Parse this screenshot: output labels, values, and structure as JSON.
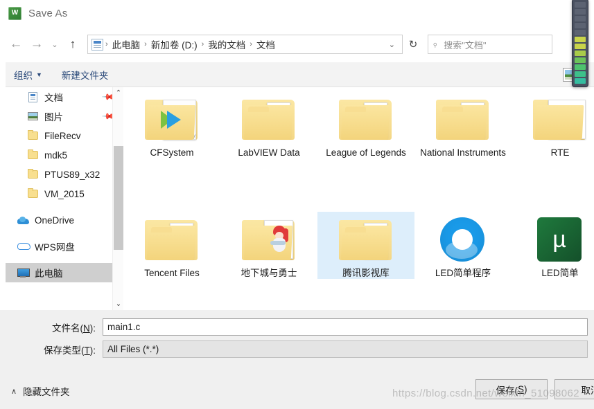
{
  "window": {
    "title": "Save As",
    "app_icon": "wps-icon"
  },
  "nav": {
    "back_icon": "arrow-left-icon",
    "forward_icon": "arrow-right-icon",
    "recent_icon": "chevron-down-icon",
    "up_icon": "arrow-up-icon",
    "refresh_icon": "refresh-icon",
    "address_icon": "document-icon",
    "breadcrumbs": [
      "此电脑",
      "新加卷 (D:)",
      "我的文档",
      "文档"
    ],
    "separator": "›",
    "dropdown_icon": "chevron-down-icon"
  },
  "search": {
    "placeholder": "搜索\"文档\"",
    "icon": "search-icon"
  },
  "toolbar": {
    "organize_label": "组织",
    "organize_caret": "▼",
    "new_folder_label": "新建文件夹",
    "view_icon": "view-layout-icon",
    "view_caret": "▼"
  },
  "sidebar": {
    "items": [
      {
        "label": "文档",
        "icon": "document-icon",
        "indent": true,
        "pinned": true,
        "selected": false
      },
      {
        "label": "图片",
        "icon": "picture-icon",
        "indent": true,
        "pinned": true,
        "selected": false
      },
      {
        "label": "FileRecv",
        "icon": "folder-icon",
        "indent": true,
        "pinned": false,
        "selected": false
      },
      {
        "label": "mdk5",
        "icon": "folder-icon",
        "indent": true,
        "pinned": false,
        "selected": false
      },
      {
        "label": "PTUS89_x32",
        "icon": "folder-icon",
        "indent": true,
        "pinned": false,
        "selected": false
      },
      {
        "label": "VM_2015",
        "icon": "folder-icon",
        "indent": true,
        "pinned": false,
        "selected": false
      },
      {
        "label": "OneDrive",
        "icon": "onedrive-icon",
        "indent": false,
        "pinned": false,
        "selected": false
      },
      {
        "label": "WPS网盘",
        "icon": "wps-cloud-icon",
        "indent": false,
        "pinned": false,
        "selected": false
      },
      {
        "label": "此电脑",
        "icon": "this-pc-icon",
        "indent": false,
        "pinned": false,
        "selected": true
      }
    ],
    "scroll_up_icon": "chevron-up-icon",
    "scroll_down_icon": "chevron-down-icon"
  },
  "files": {
    "row1": [
      {
        "label": "CFSystem",
        "icon": "folder-vcd-icon",
        "selected": false
      },
      {
        "label": "LabVIEW Data",
        "icon": "folder-icon",
        "selected": false
      },
      {
        "label": "League of Legends",
        "icon": "folder-icon",
        "selected": false
      },
      {
        "label": "National Instruments",
        "icon": "folder-icon",
        "selected": false
      },
      {
        "label": "RTE",
        "icon": "folder-blank-icon",
        "selected": false
      }
    ],
    "row2": [
      {
        "label": "Tencent Files",
        "icon": "folder-icon",
        "selected": false
      },
      {
        "label": "地下城与勇士",
        "icon": "folder-character-icon",
        "selected": false
      },
      {
        "label": "腾讯影视库",
        "icon": "folder-icon",
        "selected": true
      },
      {
        "label": "LED简单程序",
        "icon": "circle-logo-icon",
        "selected": false
      },
      {
        "label": "LED简单",
        "icon": "green-app-icon",
        "selected": false
      }
    ]
  },
  "form": {
    "filename_label_pre": "文件名(",
    "filename_label_key": "N",
    "filename_label_post": "):",
    "filename_value": "main1.c",
    "filetype_label_pre": "保存类型(",
    "filetype_label_key": "T",
    "filetype_label_post": "):",
    "filetype_value": "All Files (*.*)"
  },
  "footer": {
    "hide_folders_label": "隐藏文件夹",
    "hide_folders_caret": "∧",
    "save_label_pre": "保存(",
    "save_label_key": "S",
    "save_label_post": ")",
    "cancel_label": "取消"
  },
  "watermark": {
    "text": "https://blog.csdn.net/weixin_51098062"
  },
  "colors": {
    "folder_yellow": "#f8df8f",
    "accent_blue": "#2b4a7a",
    "selection_blue": "#ddeefb",
    "sidebar_selected": "#cfcfcf",
    "chrome_gray": "#f0f0f0"
  }
}
